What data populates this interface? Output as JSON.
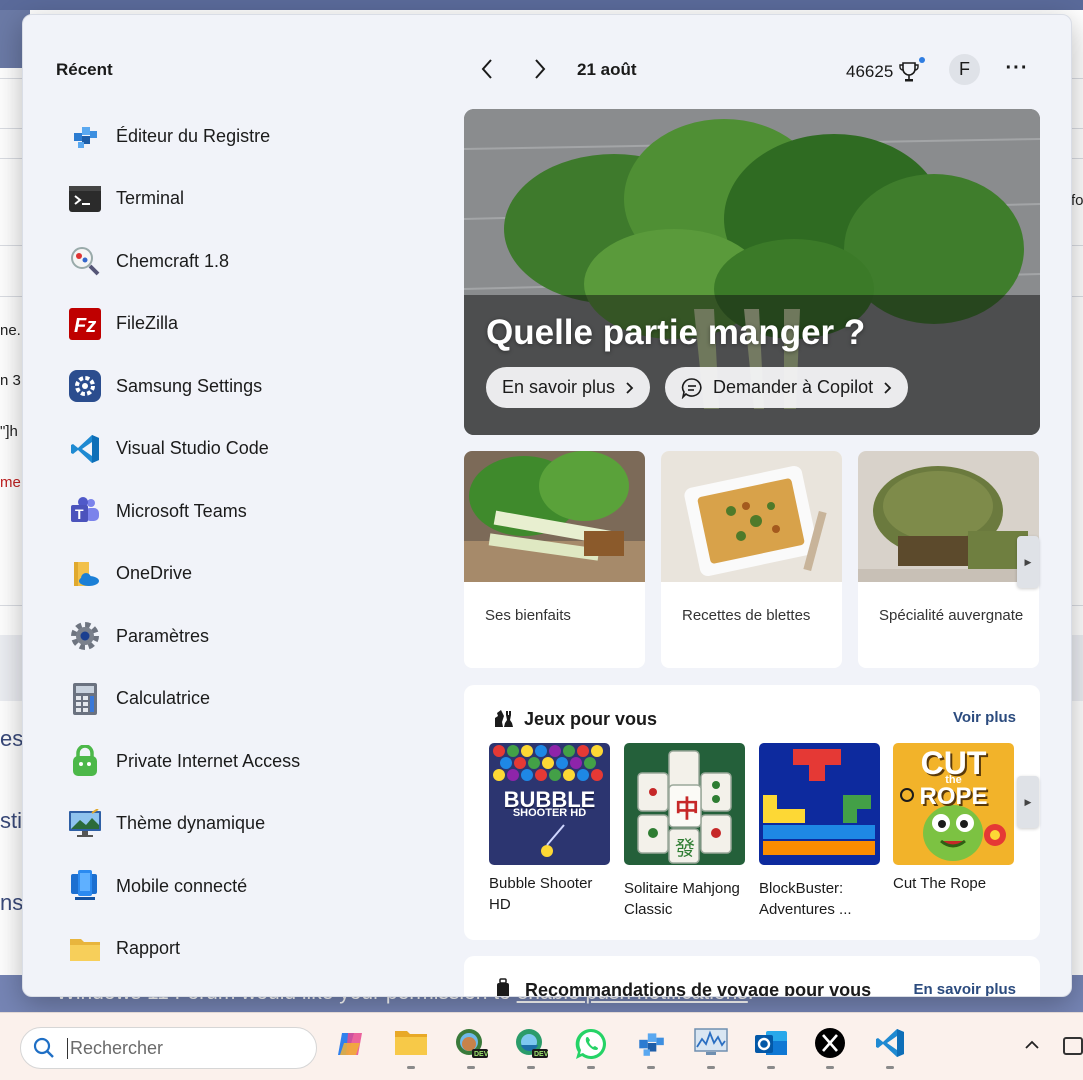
{
  "background_page": {
    "fragments": [
      "ne.",
      "n 3",
      "\"]h",
      "me",
      "es",
      "sti",
      "ns",
      "fo"
    ],
    "notice_prefix": "Windows 11 Forum would like your permission to ",
    "notice_link": "enable push notifications",
    "notice_suffix": "."
  },
  "widgets": {
    "recent": {
      "title": "Récent",
      "items": [
        {
          "label": "Éditeur du Registre",
          "icon": "registry-editor-icon"
        },
        {
          "label": "Terminal",
          "icon": "terminal-icon"
        },
        {
          "label": "Chemcraft 1.8",
          "icon": "chemcraft-icon"
        },
        {
          "label": "FileZilla",
          "icon": "filezilla-icon"
        },
        {
          "label": "Samsung Settings",
          "icon": "samsung-settings-icon"
        },
        {
          "label": "Visual Studio Code",
          "icon": "vscode-icon"
        },
        {
          "label": "Microsoft Teams",
          "icon": "teams-icon"
        },
        {
          "label": "OneDrive",
          "icon": "onedrive-icon"
        },
        {
          "label": "Paramètres",
          "icon": "settings-gear-icon"
        },
        {
          "label": "Calculatrice",
          "icon": "calculator-icon"
        },
        {
          "label": "Private Internet Access",
          "icon": "pia-icon"
        },
        {
          "label": "Thème dynamique",
          "icon": "dynamic-theme-icon"
        },
        {
          "label": "Mobile connecté",
          "icon": "phone-link-icon"
        },
        {
          "label": "Rapport",
          "icon": "folder-icon"
        }
      ]
    },
    "header": {
      "date": "21 août",
      "points": "46625",
      "avatar_initial": "F",
      "more": "···"
    },
    "hero": {
      "title": "Quelle partie manger ?",
      "learn_more": "En savoir plus",
      "ask_copilot": "Demander à Copilot"
    },
    "cards": [
      {
        "label": "Ses bienfaits"
      },
      {
        "label": "Recettes de blettes"
      },
      {
        "label": "Spécialité auvergnate"
      }
    ],
    "games": {
      "title": "Jeux pour vous",
      "see_more": "Voir plus",
      "items": [
        {
          "label": "Bubble Shooter HD",
          "thumb_text": "BUBBLE",
          "thumb_sub": "SHOOTER HD"
        },
        {
          "label": "Solitaire Mahjong Classic"
        },
        {
          "label": "BlockBuster: Adventures ..."
        },
        {
          "label": "Cut The Rope",
          "thumb_text": "CUT",
          "thumb_sub": "ROPE",
          "thumb_mid": "the"
        }
      ]
    },
    "travel": {
      "title": "Recommandations de voyage pour vous",
      "learn_more": "En savoir plus"
    }
  },
  "taskbar": {
    "search_placeholder": "Rechercher",
    "apps": [
      "copilot-icon",
      "file-explorer-icon",
      "edge-dev-icon",
      "edge-dev-alt-icon",
      "whatsapp-icon",
      "registry-editor-icon",
      "performance-monitor-icon",
      "outlook-icon",
      "x-icon",
      "vscode-icon"
    ]
  },
  "colors": {
    "panel_bg": "#f1f3f9",
    "link_blue": "#2b4b7e",
    "taskbar_bg": "#fbf1ec"
  }
}
